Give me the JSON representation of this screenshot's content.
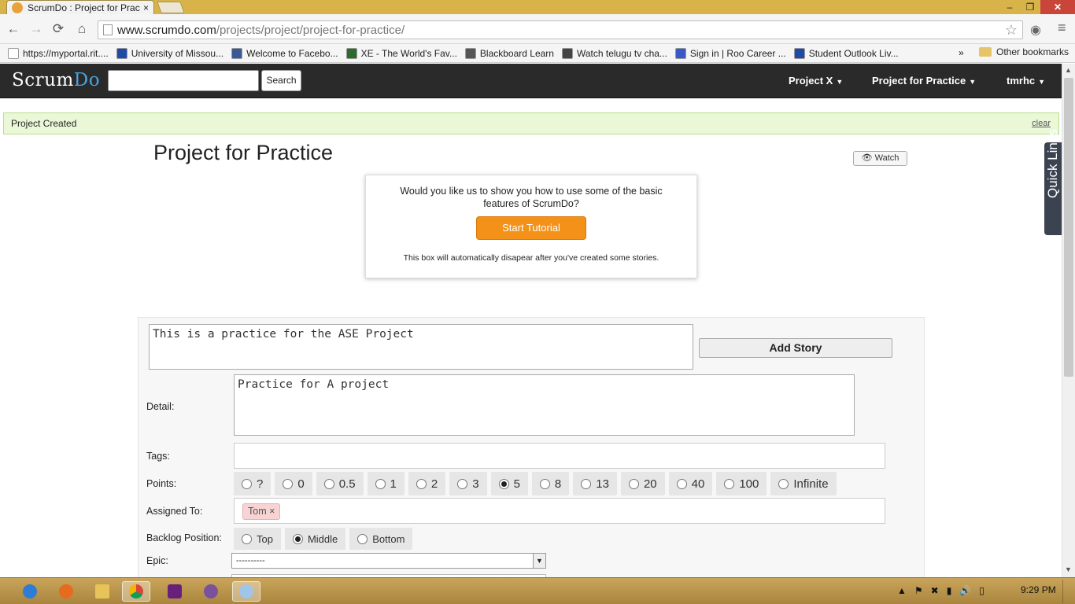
{
  "browser": {
    "tab_title": "ScrumDo : Project for Prac",
    "tab_close": "×",
    "url_host": "www.scrumdo.com",
    "url_path": "/projects/project/project-for-practice/",
    "nav": {
      "back": "←",
      "forward": "→",
      "reload": "⟳",
      "home": "⌂"
    },
    "window_controls": {
      "minimize": "–",
      "restore": "❐",
      "close": "✕"
    }
  },
  "bookmarks": {
    "items": [
      {
        "label": "https://myportal.rit....",
        "color": "#ffffff"
      },
      {
        "label": "University of Missou...",
        "color": "#1f4aa8"
      },
      {
        "label": "Welcome to Facebo...",
        "color": "#3b5998"
      },
      {
        "label": "XE - The World's Fav...",
        "color": "#2d6a2d"
      },
      {
        "label": "Blackboard Learn",
        "color": "#555555"
      },
      {
        "label": "Watch telugu tv cha...",
        "color": "#444444"
      },
      {
        "label": "Sign in | Roo Career ...",
        "color": "#3a58c8"
      },
      {
        "label": "Student Outlook Liv...",
        "color": "#1f4aa8"
      }
    ],
    "more": "»",
    "other": "Other bookmarks"
  },
  "app": {
    "logo_scrum": "Scrum",
    "logo_do": "Do",
    "search_button": "Search",
    "menus": [
      "Project X",
      "Project for Practice",
      "tmrhc"
    ],
    "caret": "▼"
  },
  "flash": {
    "message": "Project Created",
    "clear": "clear"
  },
  "project": {
    "title": "Project for Practice",
    "watch": "Watch"
  },
  "tutorial": {
    "question": "Would you like us to show you how to use some of the basic features of ScrumDo?",
    "button": "Start Tutorial",
    "note": "This box will automatically disapear after you've created some stories."
  },
  "story_form": {
    "summary_value": "This is a practice for the ASE Project",
    "add_story_button": "Add Story",
    "detail_label": "Detail:",
    "detail_value": "Practice for A project",
    "tags_label": "Tags:",
    "points_label": "Points:",
    "points_options": [
      "?",
      "0",
      "0.5",
      "1",
      "2",
      "3",
      "5",
      "8",
      "13",
      "20",
      "40",
      "100",
      "Infinite"
    ],
    "points_selected": "5",
    "assigned_label": "Assigned To:",
    "assigned_chip": "Tom",
    "chip_remove": "×",
    "backlog_label": "Backlog Position:",
    "backlog_options": [
      "Top",
      "Middle",
      "Bottom"
    ],
    "backlog_selected": "Middle",
    "epic_label": "Epic:",
    "epic_value": "----------"
  },
  "quick_links": "Quick Links",
  "taskbar": {
    "apps": [
      "internet-explorer",
      "firefox",
      "file-explorer",
      "chrome",
      "visual-studio",
      "viber",
      "paint"
    ],
    "time": "9:29 PM"
  }
}
